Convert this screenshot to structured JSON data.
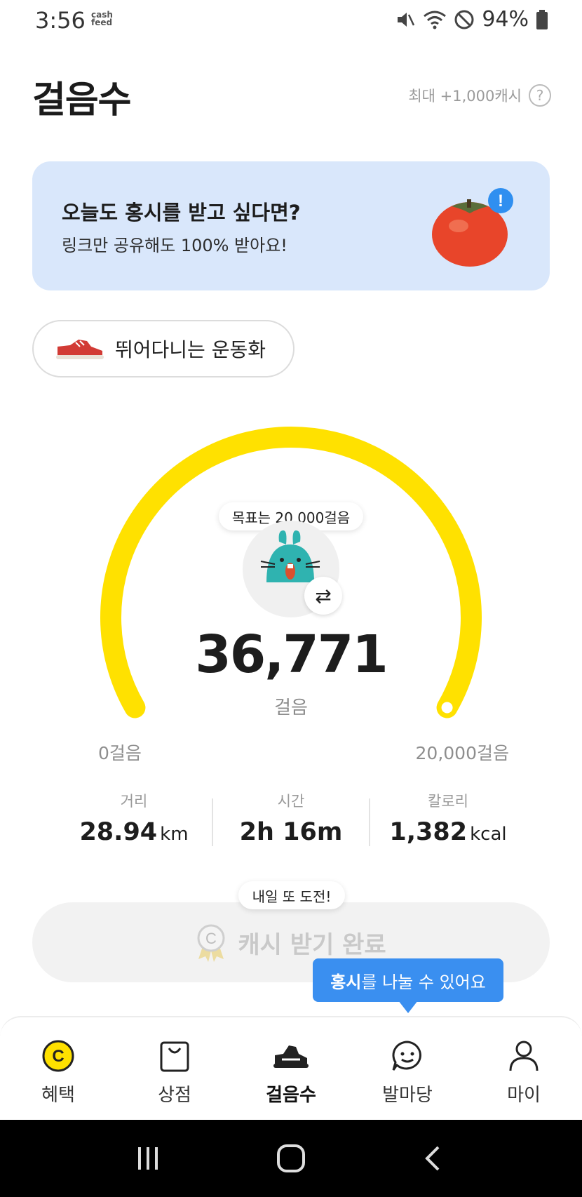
{
  "status_bar": {
    "time": "3:56",
    "app_badge_line1": "cash",
    "app_badge_line2": "feed",
    "battery": "94%"
  },
  "header": {
    "title": "걸음수",
    "max_reward": "최대 +1,000캐시",
    "help_glyph": "?"
  },
  "banner": {
    "title": "오늘도 홍시를 받고 싶다면?",
    "subtitle": "링크만 공유해도 100% 받아요!",
    "badge_glyph": "!"
  },
  "shoe_chip": {
    "label": "뛰어다니는 운동화"
  },
  "gauge": {
    "goal_label": "목표는 20,000걸음",
    "steps": "36,771",
    "unit": "걸음",
    "min_label": "0걸음",
    "max_label": "20,000걸음",
    "progress": 1.0,
    "color": "#FFE100",
    "swap_glyph": "⇄"
  },
  "stats": [
    {
      "label": "거리",
      "value": "28.94",
      "unit": "km"
    },
    {
      "label": "시간",
      "value": "2h 16m",
      "unit": ""
    },
    {
      "label": "칼로리",
      "value": "1,382",
      "unit": "kcal"
    }
  ],
  "challenge": {
    "bubble": "내일 또 도전!",
    "button_label": "캐시 받기 완료"
  },
  "tooltip": {
    "bold": "홍시",
    "rest": "를 나눌 수 있어요"
  },
  "tabs": [
    {
      "label": "혜택",
      "icon": "coin-icon"
    },
    {
      "label": "상점",
      "icon": "bag-icon"
    },
    {
      "label": "걸음수",
      "icon": "shoe-icon",
      "active": true
    },
    {
      "label": "발마당",
      "icon": "chat-icon"
    },
    {
      "label": "마이",
      "icon": "person-icon"
    }
  ],
  "colors": {
    "accent_yellow": "#FFE100",
    "banner_bg": "#D9E7FB",
    "tooltip_blue": "#3A8FF0"
  }
}
